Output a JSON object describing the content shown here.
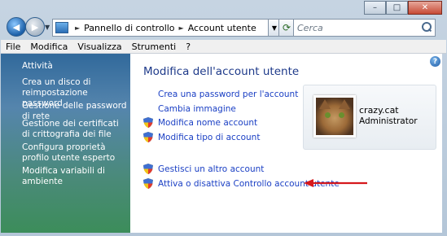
{
  "window": {
    "minimize_symbol": "–",
    "maximize_symbol": "□",
    "close_symbol": "✕"
  },
  "address_bar": {
    "crumbs": [
      "Pannello di controllo",
      "Account utente"
    ],
    "separator": "►",
    "search_placeholder": "Cerca"
  },
  "menu": {
    "items": [
      "File",
      "Modifica",
      "Visualizza",
      "Strumenti",
      "?"
    ]
  },
  "sidebar": {
    "items": [
      "Attività",
      "Crea un disco di reimpostazione password",
      "Gestione delle password di rete",
      "Gestione dei certificati di crittografia dei file",
      "Configura proprietà profilo utente esperto",
      "Modifica variabili di ambiente"
    ]
  },
  "main": {
    "title": "Modifica dell'account utente",
    "links": [
      "Crea una password per l'account",
      "Cambia immagine",
      "Modifica nome account",
      "Modifica tipo di account",
      "Gestisci un altro account",
      "Attiva o disattiva Controllo account utente"
    ],
    "help_symbol": "?"
  },
  "account": {
    "name": "crazy.cat",
    "role": "Administrator"
  },
  "colors": {
    "link": "#1a3fc4",
    "title": "#1e3a8a",
    "annotation_arrow": "#d6191c"
  }
}
